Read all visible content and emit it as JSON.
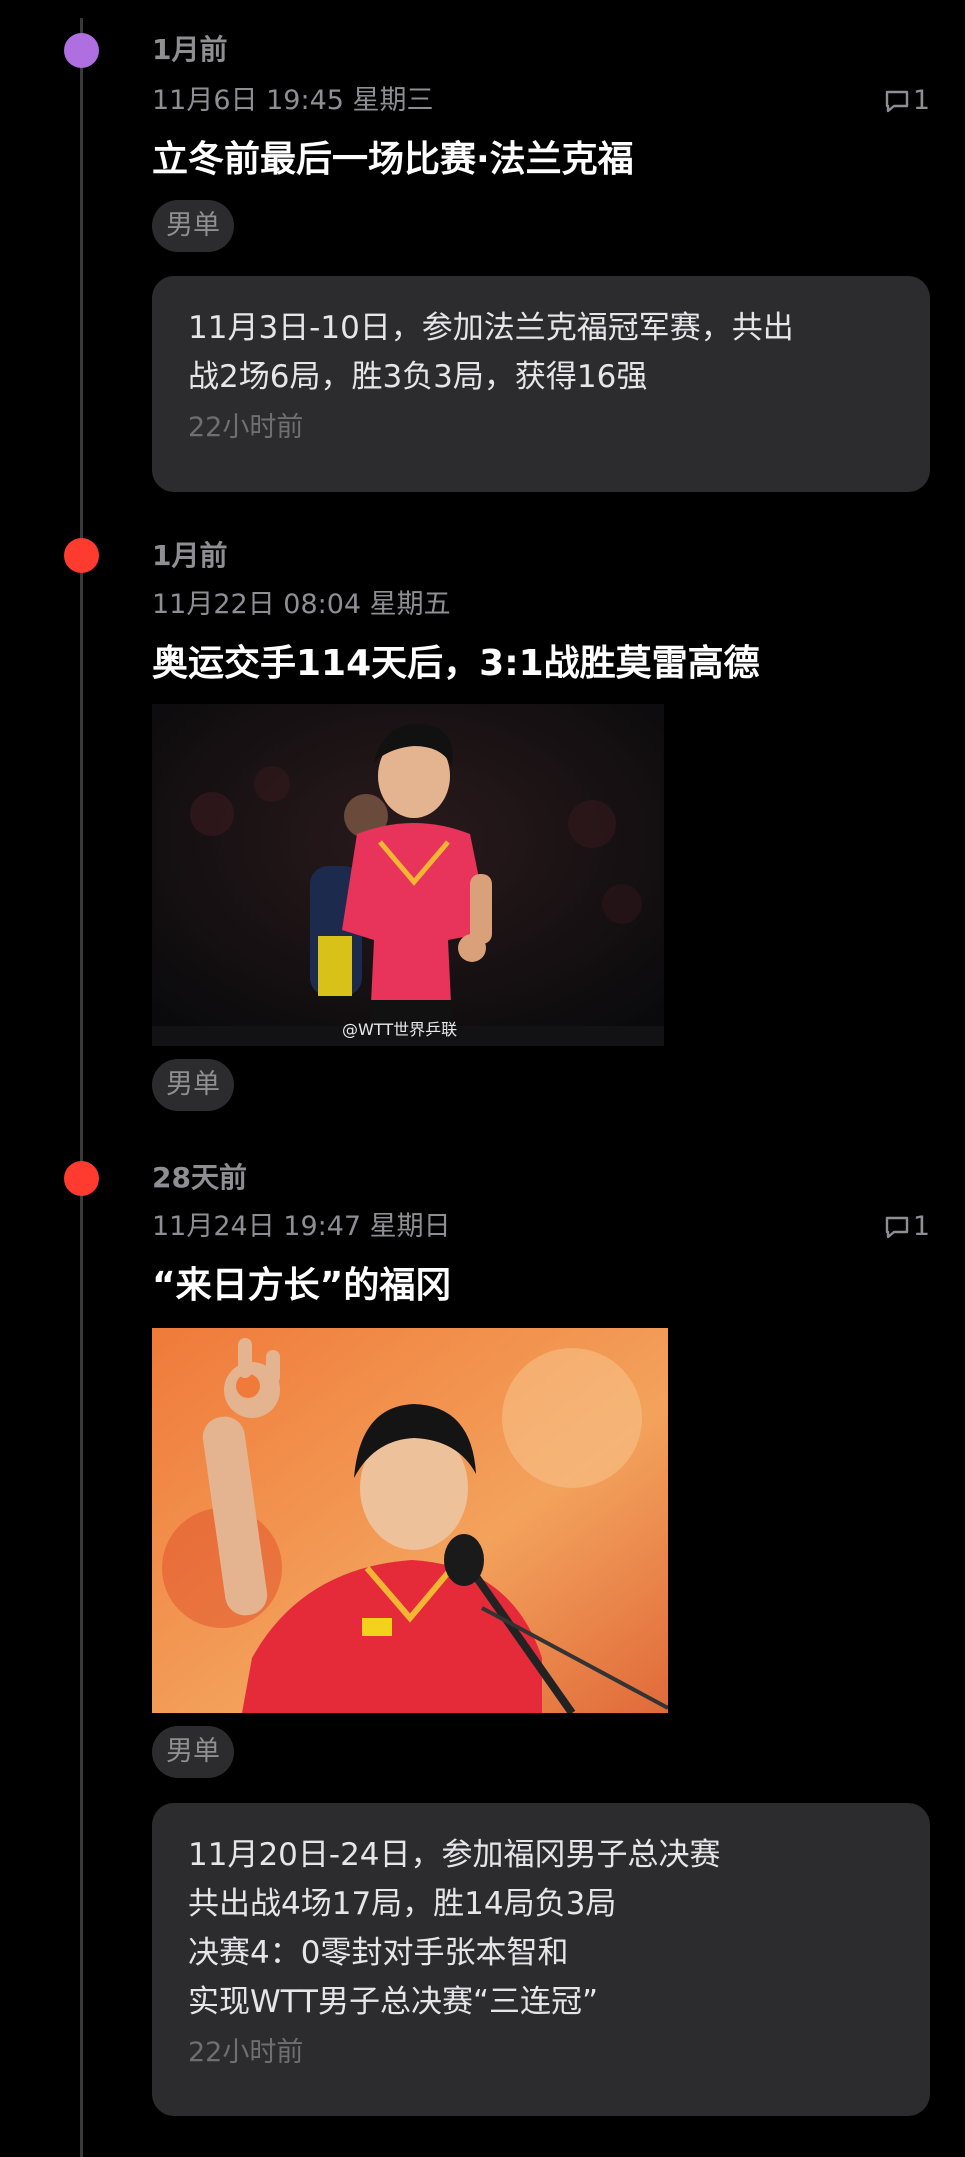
{
  "timeline": {
    "entries": [
      {
        "dot_color": "#b06fe0",
        "relative_time": "1月前",
        "date": "11月6日 19:45 星期三",
        "comments": "1",
        "title": "立冬前最后一场比赛·法兰克福",
        "tag": "男单",
        "note": {
          "lines": [
            "11月3日-10日，参加法兰克福冠军赛，共出",
            "战2场6局，胜3负3局，获得16强"
          ],
          "time": "22小时前"
        }
      },
      {
        "dot_color": "#ff3b30",
        "relative_time": "1月前",
        "date": "11月22日 08:04 星期五",
        "title": "奥运交手114天后，3:1战胜莫雷高德",
        "photo_watermark": "@WTT世界乒联",
        "tag": "男单"
      },
      {
        "dot_color": "#ff3b30",
        "relative_time": "28天前",
        "date": "11月24日 19:47 星期日",
        "comments": "1",
        "title": "“来日方长”的福冈",
        "tag": "男单",
        "note": {
          "lines": [
            "11月20日-24日，参加福冈男子总决赛",
            "共出战4场17局，胜14局负3局",
            "决赛4：0零封对手张本智和",
            "实现WTT男子总决赛“三连冠”"
          ],
          "time": "22小时前"
        }
      }
    ]
  },
  "icons": {
    "comment": "comment-bubble-icon"
  },
  "colors": {
    "background": "#000000",
    "card": "#2c2c2e",
    "muted_text": "#8e8e93",
    "accent_purple": "#b06fe0",
    "accent_red": "#ff3b30"
  }
}
